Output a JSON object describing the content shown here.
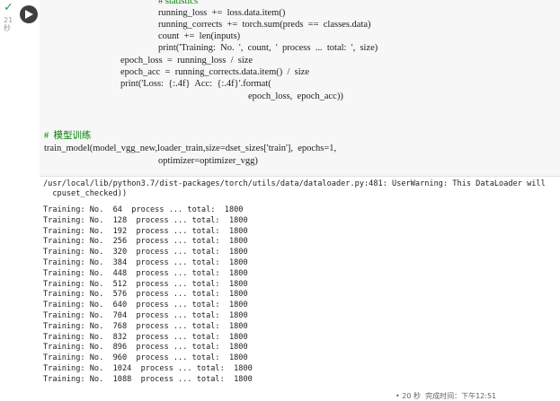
{
  "cell_status": {
    "check": "✓",
    "elapsed": "21 秒"
  },
  "code_lines": [
    {
      "text": "# statistics",
      "indent": 4,
      "class": "comment"
    },
    {
      "text": "running_loss  +=  loss.data.item()",
      "indent": 4,
      "class": ""
    },
    {
      "text": "running_corrects  +=  torch.sum(preds  ==  classes.data)",
      "indent": 4,
      "class": ""
    },
    {
      "text": "count  +=  len(inputs)",
      "indent": 4,
      "class": ""
    },
    {
      "text": "print('Training:  No.  ',  count,  '  process  ...  total:  ',  size)",
      "indent": 4,
      "class": ""
    },
    {
      "text": "epoch_loss  =  running_loss  /  size",
      "indent": 2,
      "class": ""
    },
    {
      "text": "epoch_acc  =  running_corrects.data.item()  /  size",
      "indent": 2,
      "class": ""
    },
    {
      "text": "print('Loss:  {:.4f}  Acc:  {:.4f}'.format(",
      "indent": 2,
      "class": ""
    },
    {
      "text": "epoch_loss,  epoch_acc))",
      "indent": 6,
      "class": ""
    },
    {
      "text": "",
      "indent": 0,
      "class": ""
    },
    {
      "text": "",
      "indent": 0,
      "class": ""
    },
    {
      "text": "#  模型训练",
      "indent": 0,
      "class": "comment"
    },
    {
      "text": "train_model(model_vgg_new,loader_train,size=dset_sizes['train'],  epochs=1,",
      "indent": 0,
      "class": ""
    },
    {
      "text": "optimizer=optimizer_vgg)",
      "indent": 6,
      "class": ""
    }
  ],
  "output": {
    "warning_line1": "/usr/local/lib/python3.7/dist-packages/torch/utils/data/dataloader.py:481: UserWarning: This DataLoader will",
    "warning_line2": "  cpuset_checked))",
    "training_lines": [
      "Training: No.  64  process ... total:  1800",
      "Training: No.  128  process ... total:  1800",
      "Training: No.  192  process ... total:  1800",
      "Training: No.  256  process ... total:  1800",
      "Training: No.  320  process ... total:  1800",
      "Training: No.  384  process ... total:  1800",
      "Training: No.  448  process ... total:  1800",
      "Training: No.  512  process ... total:  1800",
      "Training: No.  576  process ... total:  1800",
      "Training: No.  640  process ... total:  1800",
      "Training: No.  704  process ... total:  1800",
      "Training: No.  768  process ... total:  1800",
      "Training: No.  832  process ... total:  1800",
      "Training: No.  896  process ... total:  1800",
      "Training: No.  960  process ... total:  1800",
      "Training: No.  1024  process ... total:  1800",
      "Training: No.  1088  process ... total:  1800"
    ]
  },
  "footer_status": "• 20 秒  完成时间：下午12:51"
}
